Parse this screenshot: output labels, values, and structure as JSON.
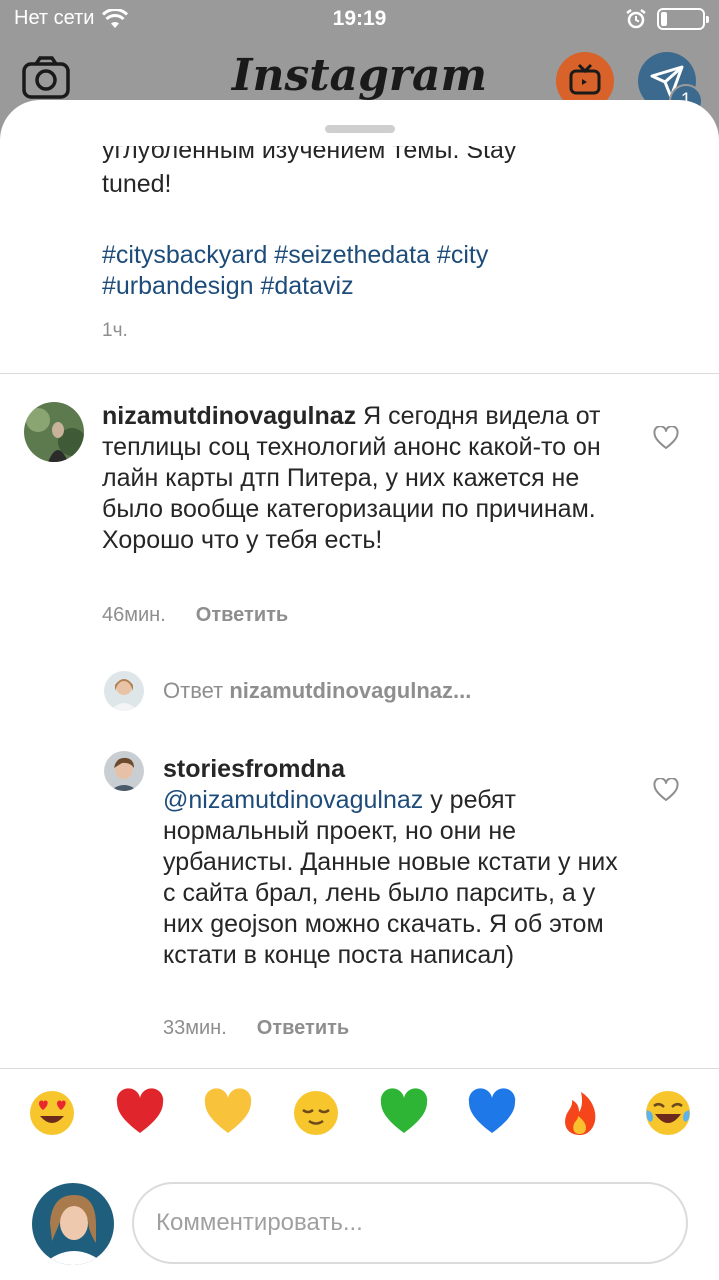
{
  "status_bar": {
    "carrier": "Нет сети",
    "time": "19:19",
    "battery_level": 0.15,
    "icons": [
      "wifi-icon",
      "alarm-icon",
      "battery-icon"
    ]
  },
  "header": {
    "logo": "Instagram",
    "direct_badge": "1",
    "icons": [
      "camera-icon",
      "igtv-icon",
      "direct-icon"
    ]
  },
  "post": {
    "caption_cut_line": "углубленным изучением темы. Stay",
    "caption_tail": "tuned!",
    "hashtags": [
      "#citysbackyard",
      "#seizethedata",
      "#city",
      "#urbandesign",
      "#dataviz"
    ],
    "hashtags_line1": "#citysbackyard #seizethedata #city",
    "hashtags_line2": "#urbandesign #dataviz",
    "time": "1ч."
  },
  "comments": [
    {
      "username": "nizamutdinovagulnaz",
      "text": "Я сегодня видела от теплицы соц технологий анонс какой-то он лайн карты дтп Питера, у них кажется не было вообще категоризации по причинам. Хорошо что у тебя есть!",
      "time": "46мин.",
      "reply_label": "Ответить"
    }
  ],
  "replies_toggle": {
    "prefix": "Ответ",
    "username": "nizamutdinovagulnaz..."
  },
  "reply": {
    "username": "storiesfromdna",
    "mention": "@nizamutdinovagulnaz",
    "text": "у ребят нормальный проект, но они не урбанисты. Данные новые кстати у них с сайта брал, лень было парсить, а у них geojson можно скачать. Я об этом кстати в конце поста написал)",
    "time": "33мин.",
    "reply_label": "Ответить"
  },
  "quick_emoji": [
    "😍",
    "❤️",
    "💛",
    "😌",
    "💚",
    "💙",
    "🔥",
    "😂"
  ],
  "comment_input": {
    "placeholder": "Комментировать..."
  },
  "colors": {
    "link": "#1e4c7a",
    "meta": "#8e8e8e",
    "text": "#262626",
    "overlay": "#9a9a9a"
  }
}
